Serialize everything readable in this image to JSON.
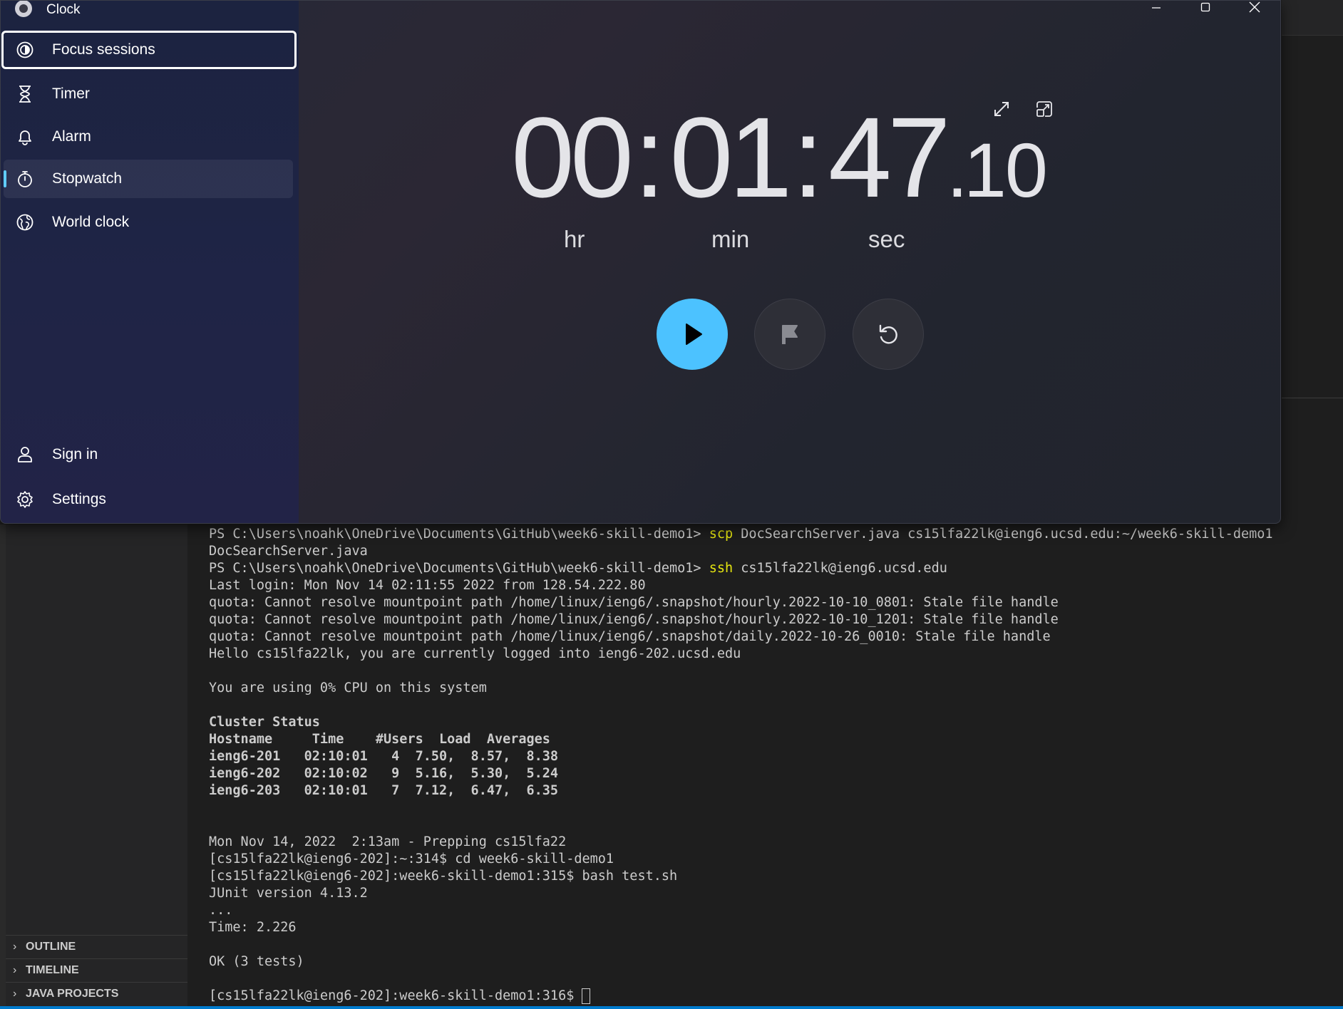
{
  "clock_app": {
    "title": "Clock",
    "nav": {
      "items": [
        {
          "label": "Focus sessions",
          "icon": "focus-icon"
        },
        {
          "label": "Timer",
          "icon": "hourglass-icon"
        },
        {
          "label": "Alarm",
          "icon": "bell-icon"
        },
        {
          "label": "Stopwatch",
          "icon": "stopwatch-icon"
        },
        {
          "label": "World clock",
          "icon": "globe-icon"
        }
      ],
      "footer": [
        {
          "label": "Sign in",
          "icon": "person-icon"
        },
        {
          "label": "Settings",
          "icon": "gear-icon"
        }
      ],
      "selected": "Stopwatch",
      "focused": "Focus sessions"
    },
    "stopwatch": {
      "hours": "00",
      "minutes": "01",
      "seconds": "47",
      "fraction": "10",
      "unit_labels": {
        "hr": "hr",
        "min": "min",
        "sec": "sec"
      }
    },
    "colors": {
      "accent": "#4cc2ff",
      "selection_pill": "#60cdff"
    }
  },
  "vscode": {
    "panels": {
      "outline": "OUTLINE",
      "timeline": "TIMELINE",
      "java_projects": "JAVA PROJECTS"
    },
    "terminal": {
      "lines": [
        {
          "parts": [
            {
              "t": "PS C:\\Users\\noahk\\OneDrive\\Documents\\GitHub\\week6-skill-demo1> "
            },
            {
              "t": "scp",
              "c": "yellow"
            },
            {
              "t": " DocSearchServer.java cs15lfa22lk@ieng6.ucsd.edu:~/week6-skill-demo1"
            }
          ]
        },
        {
          "parts": [
            {
              "t": "DocSearchServer.java"
            }
          ]
        },
        {
          "parts": [
            {
              "t": "PS C:\\Users\\noahk\\OneDrive\\Documents\\GitHub\\week6-skill-demo1> "
            },
            {
              "t": "ssh",
              "c": "yellow"
            },
            {
              "t": " cs15lfa22lk@ieng6.ucsd.edu"
            }
          ]
        },
        {
          "parts": [
            {
              "t": "Last login: Mon Nov 14 02:11:55 2022 from 128.54.222.80"
            }
          ]
        },
        {
          "parts": [
            {
              "t": "quota: Cannot resolve mountpoint path /home/linux/ieng6/.snapshot/hourly.2022-10-10_0801: Stale file handle"
            }
          ]
        },
        {
          "parts": [
            {
              "t": "quota: Cannot resolve mountpoint path /home/linux/ieng6/.snapshot/hourly.2022-10-10_1201: Stale file handle"
            }
          ]
        },
        {
          "parts": [
            {
              "t": "quota: Cannot resolve mountpoint path /home/linux/ieng6/.snapshot/daily.2022-10-26_0010: Stale file handle"
            }
          ]
        },
        {
          "parts": [
            {
              "t": "Hello cs15lfa22lk, you are currently logged into ieng6-202.ucsd.edu"
            }
          ]
        },
        {
          "parts": [
            {
              "t": ""
            }
          ]
        },
        {
          "parts": [
            {
              "t": "You are using 0% CPU on this system"
            }
          ]
        },
        {
          "parts": [
            {
              "t": ""
            }
          ]
        },
        {
          "parts": [
            {
              "t": "Cluster Status"
            }
          ],
          "bold": true
        },
        {
          "parts": [
            {
              "t": "Hostname     Time    #Users  Load  Averages"
            }
          ],
          "bold": true
        },
        {
          "parts": [
            {
              "t": "ieng6-201   02:10:01   4  7.50,  8.57,  8.38"
            }
          ],
          "bold": true
        },
        {
          "parts": [
            {
              "t": "ieng6-202   02:10:02   9  5.16,  5.30,  5.24"
            }
          ],
          "bold": true
        },
        {
          "parts": [
            {
              "t": "ieng6-203   02:10:01   7  7.12,  6.47,  6.35"
            }
          ],
          "bold": true
        },
        {
          "parts": [
            {
              "t": ""
            }
          ]
        },
        {
          "parts": [
            {
              "t": ""
            }
          ]
        },
        {
          "parts": [
            {
              "t": "Mon Nov 14, 2022  2:13am - Prepping cs15lfa22"
            }
          ]
        },
        {
          "parts": [
            {
              "t": "[cs15lfa22lk@ieng6-202]:~:314$ cd week6-skill-demo1"
            }
          ]
        },
        {
          "parts": [
            {
              "t": "[cs15lfa22lk@ieng6-202]:week6-skill-demo1:315$ bash test.sh"
            }
          ]
        },
        {
          "parts": [
            {
              "t": "JUnit version 4.13.2"
            }
          ]
        },
        {
          "parts": [
            {
              "t": "..."
            }
          ]
        },
        {
          "parts": [
            {
              "t": "Time: 2.226"
            }
          ]
        },
        {
          "parts": [
            {
              "t": ""
            }
          ]
        },
        {
          "parts": [
            {
              "t": "OK (3 tests)"
            }
          ]
        },
        {
          "parts": [
            {
              "t": ""
            }
          ]
        },
        {
          "parts": [
            {
              "t": "[cs15lfa22lk@ieng6-202]:week6-skill-demo1:316$ "
            }
          ],
          "cursor": true
        }
      ]
    }
  }
}
